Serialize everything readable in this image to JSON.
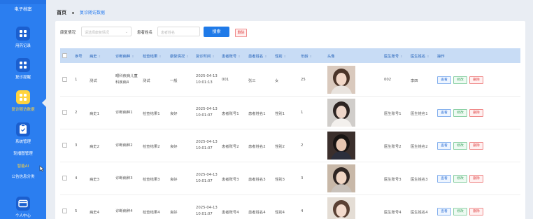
{
  "sidebar": {
    "top_label": "电子档案",
    "items": [
      {
        "label": "用药记录",
        "icon": "grid-icon",
        "active": false
      },
      {
        "label": "复诊提醒",
        "icon": "grid-icon",
        "active": false
      },
      {
        "label": "复诊随访数据",
        "icon": "grid-icon",
        "active": true
      },
      {
        "label": "系统管理",
        "icon": "clipboard-icon",
        "active": false
      }
    ],
    "text_items": [
      {
        "label": "轮播图管理",
        "highlight": false
      },
      {
        "label": "智能AI",
        "highlight": true
      },
      {
        "label": "公告信息分类",
        "highlight": false
      }
    ],
    "bottom_item": {
      "label": "个人中心",
      "icon": "card-icon"
    }
  },
  "breadcrumb": {
    "home": "首页",
    "current": "复诊随访数据"
  },
  "search": {
    "label1": "康复情况",
    "select_placeholder": "请选择康复情况",
    "label2": "患者姓名",
    "input_placeholder": "患者姓名",
    "search_button": "搜索",
    "delete_button": "删除"
  },
  "table": {
    "headers": [
      "序号",
      "病史",
      "诊断病种",
      "检查结果",
      "康复情况",
      "复诊时间",
      "患者账号",
      "患者姓名",
      "性别",
      "年龄",
      "头像",
      "医生账号",
      "医生姓名",
      "操作"
    ],
    "rows": [
      {
        "idx": "1",
        "history": "测试",
        "disease": [
          "眼科疾病儿童",
          "科疾病4"
        ],
        "result": "测试",
        "recovery": "一般",
        "date": "2025-04-13",
        "time": "10:01:13",
        "account": "001",
        "name": "张三",
        "gender": "女",
        "age": "25",
        "avatar": "avatar-girl-1",
        "doc_account": "002",
        "doc_name": "李四"
      },
      {
        "idx": "2",
        "history": "病史1",
        "disease": [
          "诊断病种1"
        ],
        "result": "检查结果1",
        "recovery": "良好",
        "date": "2025-04-13",
        "time": "10:01:07",
        "account": "患者账号1",
        "name": "患者姓名1",
        "gender": "性别1",
        "age": "1",
        "avatar": "avatar-girl-2",
        "doc_account": "医生账号1",
        "doc_name": "医生姓名1"
      },
      {
        "idx": "3",
        "history": "病史2",
        "disease": [
          "诊断病种2"
        ],
        "result": "检查结果2",
        "recovery": "良好",
        "date": "2025-04-13",
        "time": "10:01:07",
        "account": "患者账号2",
        "name": "患者姓名2",
        "gender": "性别2",
        "age": "2",
        "avatar": "avatar-boy-1",
        "doc_account": "医生账号2",
        "doc_name": "医生姓名2"
      },
      {
        "idx": "4",
        "history": "病史3",
        "disease": [
          "诊断病种3"
        ],
        "result": "检查结果3",
        "recovery": "良好",
        "date": "2025-04-13",
        "time": "10:01:07",
        "account": "患者账号3",
        "name": "患者姓名3",
        "gender": "性别3",
        "age": "3",
        "avatar": "avatar-girl-3",
        "doc_account": "医生账号3",
        "doc_name": "医生姓名3"
      },
      {
        "idx": "5",
        "history": "病史4",
        "disease": [
          "诊断病种4"
        ],
        "result": "检查结果4",
        "recovery": "良好",
        "date": "2025-04-13",
        "time": "10:01:07",
        "account": "患者账号4",
        "name": "患者姓名4",
        "gender": "性别4",
        "age": "4",
        "avatar": "avatar-girl-4",
        "doc_account": "医生账号4",
        "doc_name": "医生姓名4"
      }
    ],
    "actions": {
      "view": "查看",
      "edit": "修改",
      "delete": "删除"
    }
  },
  "colors": {
    "sidebar": "#2b7ef0",
    "active": "#ffd33d",
    "primary": "#1f7ae8",
    "header": "#c8dcf5"
  }
}
